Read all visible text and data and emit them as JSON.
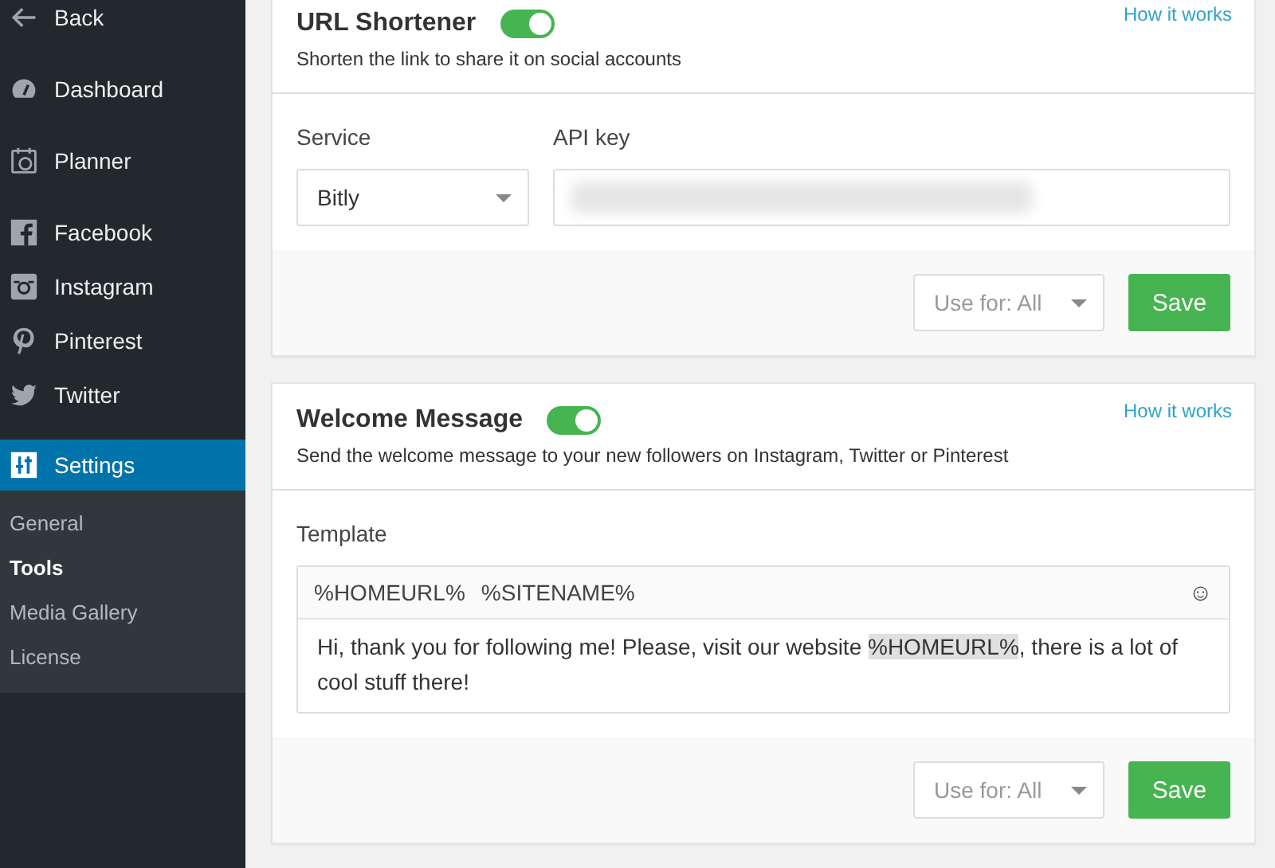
{
  "sidebar": {
    "items": [
      {
        "kind": "back",
        "label": "Back",
        "selected": false
      },
      {
        "kind": "dashboard",
        "label": "Dashboard",
        "selected": false
      },
      {
        "kind": "planner",
        "label": "Planner",
        "selected": false
      },
      {
        "kind": "facebook",
        "label": "Facebook",
        "selected": false
      },
      {
        "kind": "instagram",
        "label": "Instagram",
        "selected": false
      },
      {
        "kind": "pinterest",
        "label": "Pinterest",
        "selected": false
      },
      {
        "kind": "twitter",
        "label": "Twitter",
        "selected": false
      },
      {
        "kind": "settings",
        "label": "Settings",
        "selected": true
      }
    ],
    "submenu": [
      {
        "label": "General",
        "selected": false
      },
      {
        "label": "Tools",
        "selected": true
      },
      {
        "label": "Media Gallery",
        "selected": false
      },
      {
        "label": "License",
        "selected": false
      }
    ]
  },
  "cards": [
    {
      "kind": "shortener",
      "title": "URL Shortener",
      "enabled": true,
      "subtitle": "Shorten the link to share it on social accounts",
      "help_link": "How it works",
      "service_label": "Service",
      "service": "Bitly",
      "api_key_label": "API key",
      "use_for": "Use for: All",
      "save": "Save"
    },
    {
      "kind": "welcome",
      "title": "Welcome Message",
      "enabled": true,
      "subtitle": "Send the welcome message to your new followers on Instagram, Twitter or Pinterest",
      "help_link": "How it works",
      "template_label": "Template",
      "tokens": [
        "%HOMEURL%",
        "%SITENAME%"
      ],
      "emoji_button": "☺",
      "message": [
        {
          "text": "Hi, thank you for following me! Please, visit our website ",
          "highlighted": false
        },
        {
          "text": "%HOMEURL%",
          "highlighted": true
        },
        {
          "text": ", there is a lot of cool stuff there!",
          "highlighted": false
        }
      ],
      "use_for": "Use for: All",
      "save": "Save"
    }
  ]
}
